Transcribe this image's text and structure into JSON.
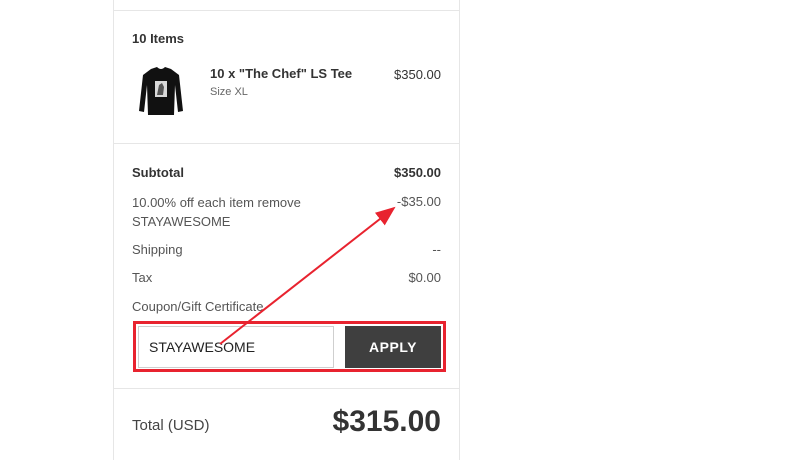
{
  "order_summary": {
    "items_heading": "10 Items",
    "item": {
      "name": "10 x \"The Chef\" LS Tee",
      "size": "Size XL",
      "price": "$350.00",
      "thumbnail_icon": "black-long-sleeve-tee-image"
    },
    "totals": {
      "subtotal_label": "Subtotal",
      "subtotal_value": "$350.00",
      "discount_line1": "10.00% off each item remove",
      "discount_line2": "STAYAWESOME",
      "discount_value": "-$35.00",
      "shipping_label": "Shipping",
      "shipping_value": "--",
      "tax_label": "Tax",
      "tax_value": "$0.00"
    },
    "coupon": {
      "label": "Coupon/Gift Certificate",
      "input_value": "STAYAWESOME",
      "apply_label": "APPLY"
    },
    "total": {
      "label": "Total (USD)",
      "value": "$315.00"
    }
  },
  "annotations": {
    "highlight_color": "#e8232f",
    "arrow_color": "#e8232f"
  }
}
